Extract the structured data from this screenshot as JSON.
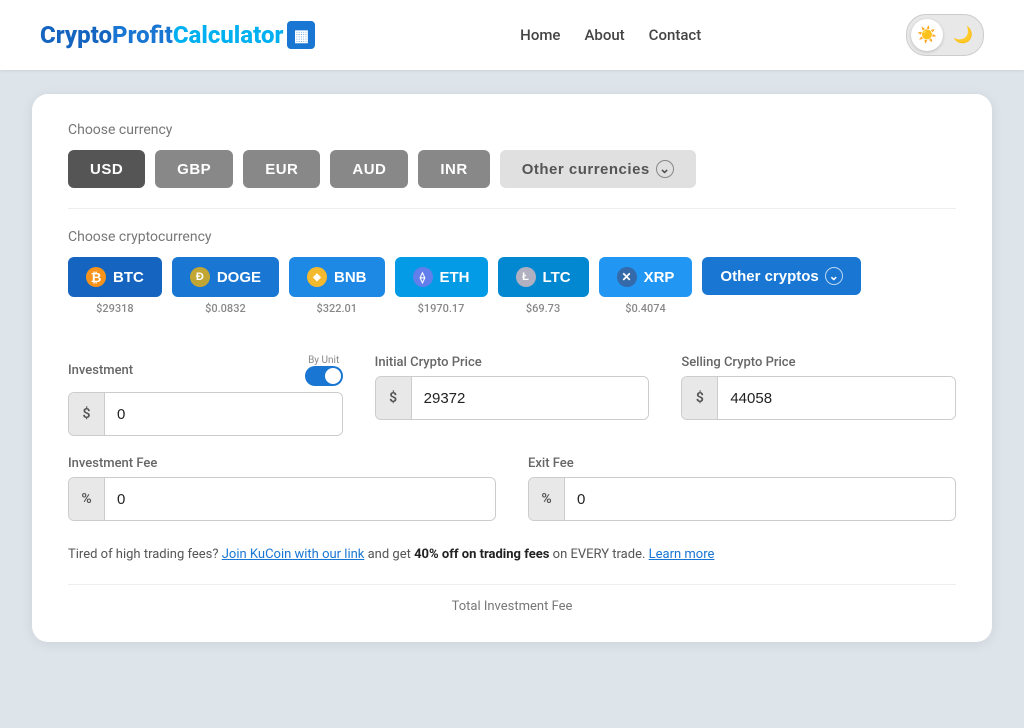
{
  "header": {
    "logo": {
      "crypto": "Crypto",
      "profit": "Profit",
      "calculator": "Calculator",
      "icon": "▦"
    },
    "nav": {
      "home": "Home",
      "about": "About",
      "contact": "Contact"
    },
    "theme": {
      "light_icon": "☀",
      "dark_icon": "🌙"
    }
  },
  "currency_section": {
    "label": "Choose currency",
    "currencies": [
      {
        "id": "usd",
        "label": "USD",
        "active": true
      },
      {
        "id": "gbp",
        "label": "GBP",
        "active": false
      },
      {
        "id": "eur",
        "label": "EUR",
        "active": false
      },
      {
        "id": "aud",
        "label": "AUD",
        "active": false
      },
      {
        "id": "inr",
        "label": "INR",
        "active": false
      }
    ],
    "other_label": "Other currencies",
    "other_chevron": "⌄"
  },
  "crypto_section": {
    "label": "Choose cryptocurrency",
    "cryptos": [
      {
        "id": "btc",
        "label": "BTC",
        "icon": "₿",
        "icon_class": "btc-icon",
        "price": "$29318"
      },
      {
        "id": "doge",
        "label": "DOGE",
        "icon": "Ð",
        "icon_class": "doge-icon",
        "price": "$0.0832"
      },
      {
        "id": "bnb",
        "label": "BNB",
        "icon": "◆",
        "icon_class": "bnb-icon",
        "price": "$322.01"
      },
      {
        "id": "eth",
        "label": "ETH",
        "icon": "⟠",
        "icon_class": "eth-icon",
        "price": "$1970.17"
      },
      {
        "id": "ltc",
        "label": "LTC",
        "icon": "Ł",
        "icon_class": "ltc-icon",
        "price": "$69.73"
      },
      {
        "id": "xrp",
        "label": "XRP",
        "icon": "✕",
        "icon_class": "xrp-icon",
        "price": "$0.4074"
      }
    ],
    "other_label": "Other cryptos",
    "other_chevron": "⌄"
  },
  "calculator": {
    "by_unit_label": "By Unit",
    "investment": {
      "label": "Investment",
      "prefix": "$",
      "value": "0",
      "placeholder": "0"
    },
    "initial_price": {
      "label": "Initial Crypto Price",
      "prefix": "$",
      "value": "29372",
      "placeholder": "29372"
    },
    "selling_price": {
      "label": "Selling Crypto Price",
      "prefix": "$",
      "value": "44058",
      "placeholder": "44058"
    },
    "investment_fee": {
      "label": "Investment Fee",
      "prefix": "%",
      "value": "0",
      "placeholder": "0"
    },
    "exit_fee": {
      "label": "Exit Fee",
      "prefix": "%",
      "value": "0",
      "placeholder": "0"
    },
    "total_fee_label": "Total Investment Fee"
  },
  "promo": {
    "text_before": "Tired of high trading fees?",
    "link1_text": "Join KuCoin with our link",
    "text_middle": "and get",
    "bold_text": "40% off on trading fees",
    "text_after": "on EVERY trade.",
    "link2_text": "Learn more"
  }
}
